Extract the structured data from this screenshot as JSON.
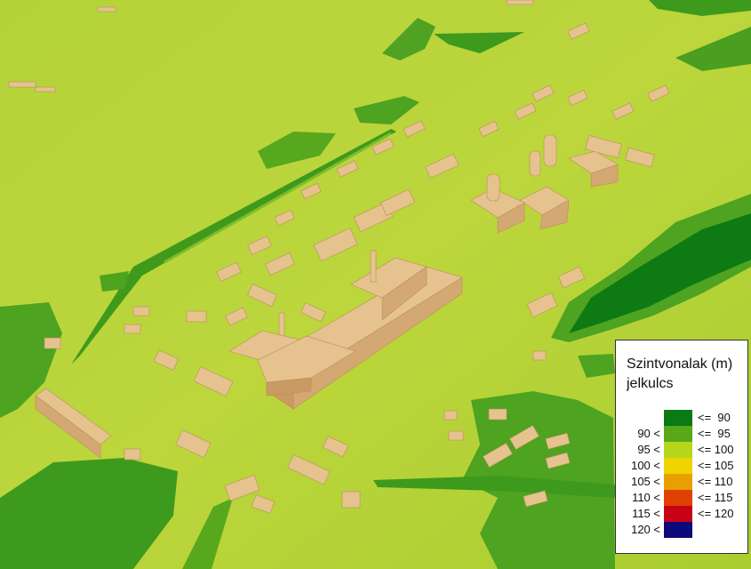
{
  "legend": {
    "title_line1": "Szintvonalak (m)",
    "title_line2": "jelkulcs",
    "classes": [
      {
        "lower": "",
        "upper": "<=  90",
        "color": "#0a7a12"
      },
      {
        "lower": "90 <",
        "upper": "<=  95",
        "color": "#58a81a"
      },
      {
        "lower": "95 <",
        "upper": "<= 100",
        "color": "#b5d71b"
      },
      {
        "lower": "100 <",
        "upper": "<= 105",
        "color": "#f0d400"
      },
      {
        "lower": "105 <",
        "upper": "<= 110",
        "color": "#e8a000"
      },
      {
        "lower": "110 <",
        "upper": "<= 115",
        "color": "#e04000"
      },
      {
        "lower": "115 <",
        "upper": "<= 120",
        "color": "#c80018"
      },
      {
        "lower": "120 <",
        "upper": "",
        "color": "#0c0a7a"
      }
    ]
  }
}
